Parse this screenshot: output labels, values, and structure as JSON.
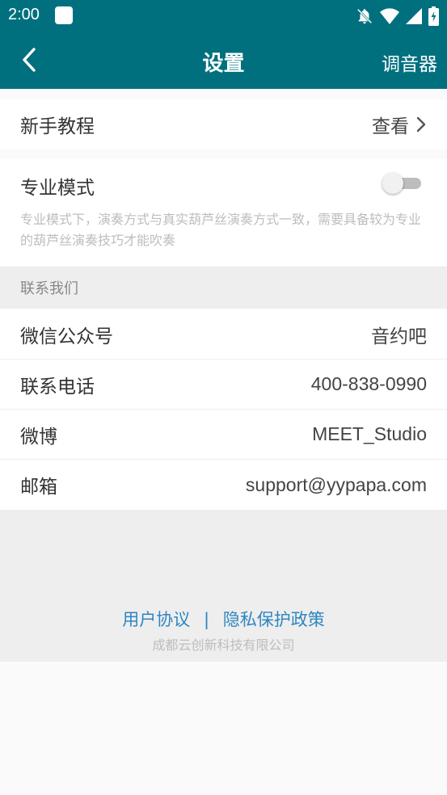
{
  "status_bar": {
    "time": "2:00"
  },
  "app_bar": {
    "title": "设置",
    "right_action": "调音器"
  },
  "tutorial": {
    "label": "新手教程",
    "value": "查看"
  },
  "pro_mode": {
    "label": "专业模式",
    "enabled": false,
    "description": "专业模式下，演奏方式与真实葫芦丝演奏方式一致，需要具备较为专业的葫芦丝演奏技巧才能吹奏"
  },
  "contact": {
    "header": "联系我们",
    "items": [
      {
        "label": "微信公众号",
        "value": "音约吧"
      },
      {
        "label": "联系电话",
        "value": "400-838-0990"
      },
      {
        "label": "微博",
        "value": "MEET_Studio"
      },
      {
        "label": "邮箱",
        "value": "support@yypapa.com"
      }
    ]
  },
  "footer": {
    "user_agreement": "用户协议",
    "separator": "|",
    "privacy_policy": "隐私保护政策",
    "company": "成都云创新科技有限公司"
  },
  "colors": {
    "primary": "#00707f",
    "link": "#2e86c1",
    "background": "#eeeeee"
  }
}
